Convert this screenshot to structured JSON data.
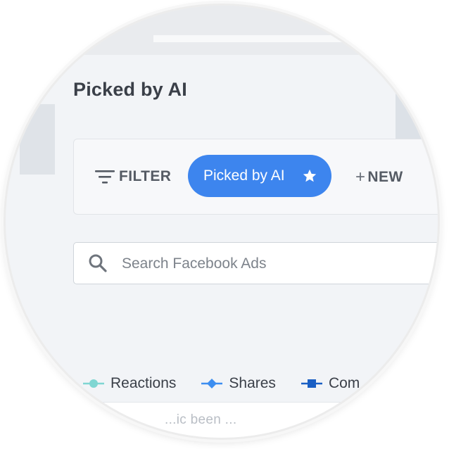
{
  "page": {
    "title": "Picked by AI"
  },
  "toolbar": {
    "filter_label": "FILTER",
    "active_chip_label": "Picked by AI",
    "new_label": "NEW",
    "new_plus": "+"
  },
  "search": {
    "placeholder": "Search Facebook Ads"
  },
  "legend": {
    "items": [
      {
        "label": "Reactions",
        "color": "#7fd6d2",
        "marker": "circle"
      },
      {
        "label": "Shares",
        "color": "#3d8ef0",
        "marker": "diamond"
      },
      {
        "label": "Com",
        "color": "#1a5fc4",
        "marker": "square"
      }
    ]
  },
  "bottom_card": {
    "text": "...ic been ..."
  },
  "colors": {
    "accent": "#3d85ee",
    "background": "#f2f4f7",
    "title_text": "#3a3f48"
  },
  "icons": {
    "filter": "filter-lines-icon",
    "star": "star-icon",
    "search": "search-icon"
  }
}
